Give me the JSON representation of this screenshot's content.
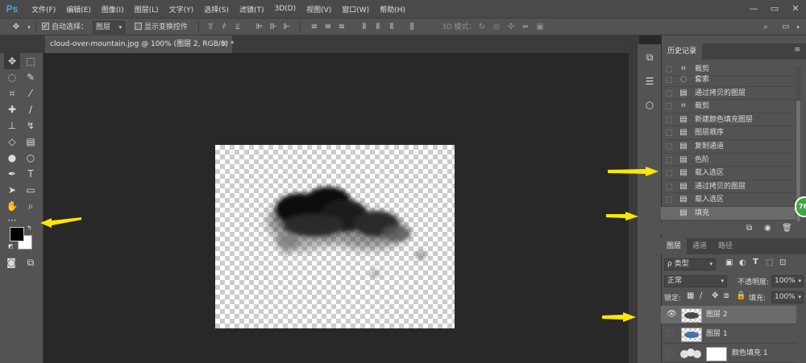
{
  "app": {
    "logo": "Ps",
    "menu": [
      "文件(F)",
      "编辑(E)",
      "图像(I)",
      "图层(L)",
      "文字(Y)",
      "选择(S)",
      "滤镜(T)",
      "3D(D)",
      "视图(V)",
      "窗口(W)",
      "帮助(H)"
    ],
    "window_buttons": [
      "—",
      "▭",
      "✕"
    ]
  },
  "options_bar": {
    "move_icon": "move-icon",
    "auto_select_label": "自动选择：",
    "auto_select_checked": true,
    "auto_select_value": "图层",
    "show_transform_label": "显示变换控件",
    "show_transform_checked": false,
    "mode_3d_label": "3D 模式："
  },
  "document_tab": {
    "title": "cloud-over-mountain.jpg @ 100% (图层 2, RGB/8) *",
    "close": "×"
  },
  "colors": {
    "foreground": "#000000",
    "background": "#ffffff",
    "accent": "#31a8ff",
    "arrow": "#ffe600"
  },
  "history_panel": {
    "tabs": [
      "历史记录"
    ],
    "items": [
      {
        "icon": "crop-icon",
        "label": "裁剪"
      },
      {
        "icon": "lasso-icon",
        "label": "套索"
      },
      {
        "icon": "doc-icon",
        "label": "通过拷贝的图层"
      },
      {
        "icon": "crop-icon",
        "label": "裁剪"
      },
      {
        "icon": "doc-icon",
        "label": "新建颜色填充图层"
      },
      {
        "icon": "doc-icon",
        "label": "图层顺序"
      },
      {
        "icon": "doc-icon",
        "label": "复制通道"
      },
      {
        "icon": "doc-icon",
        "label": "色阶"
      },
      {
        "icon": "doc-icon",
        "label": "载入选区"
      },
      {
        "icon": "doc-icon",
        "label": "通过拷贝的图层"
      },
      {
        "icon": "doc-icon",
        "label": "载入选区"
      },
      {
        "icon": "doc-icon",
        "label": "填充",
        "selected": true
      }
    ]
  },
  "badge": "76",
  "layers_panel": {
    "tabs": [
      "图层",
      "通道",
      "路径"
    ],
    "filter_label": "ρ 类型",
    "blend_mode": "正常",
    "opacity_label": "不透明度:",
    "opacity_value": "100%",
    "lock_label": "锁定:",
    "fill_label": "填充:",
    "fill_value": "100%",
    "layers": [
      {
        "name": "图层 2",
        "visible": true,
        "selected": true
      },
      {
        "name": "图层 1",
        "visible": false,
        "selected": false
      },
      {
        "name": "颜色填充 1",
        "visible": false,
        "selected": false
      }
    ]
  }
}
